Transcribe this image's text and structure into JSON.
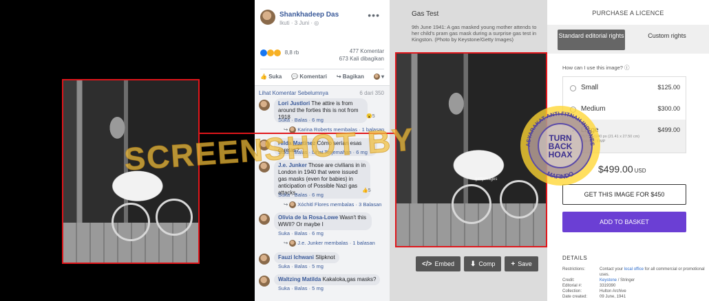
{
  "facebook": {
    "author": "Shankhadeep Das",
    "meta": "Ikuti · 3 Juni · ◎",
    "reaction_count": "8,8 rb",
    "comment_count": "477 Komentar",
    "share_count": "673 Kali dibagikan",
    "actions": [
      "Suka",
      "Komentari",
      "Bagikan"
    ],
    "view_previous": "Lihat Komentar Sebelumnya",
    "comment_counter": "6 dari 350",
    "comments": [
      {
        "author": "Lori Justlori",
        "text": "The attire is from around the forties this is not from 1918",
        "under": "Suka · Balas · 6 mg",
        "reaction": "5",
        "reply": "Karina Roberts membalas · 1 balasan"
      },
      {
        "author": "Hilda Martinez",
        "text": "Cómo serían esas caretas?",
        "under": "Suka · Balas · Lihat Terjemahan · 6 mg"
      },
      {
        "author": "J.e. Junker",
        "text": "Those are civilians in in London in 1940 that were issued gas masks (even for babies) in anticipation of Possible Nazi gas attacks.",
        "under": "Suka · Balas · 6 mg",
        "reaction": "5",
        "reply": "Xóchitl Flores membalas · 3 Balasan"
      },
      {
        "author": "Olivia de la Rosa-Lowe",
        "text": "Wasn't this WWII? Or maybe I",
        "under": "Suka · Balas · 6 mg",
        "reply": "J.e. Junker membalas · 1 balasan"
      },
      {
        "author": "Fauzi Ichwani",
        "text": "Slipknot",
        "under": "Suka · Balas · 5 mg"
      },
      {
        "author": "Waltzing Matilda",
        "text": "Kakaloka,gas masks?",
        "under": "Suka · Balas · 5 mg"
      }
    ]
  },
  "overlay": {
    "watermark": "SCREENSHOT BY",
    "stamp_ring": "MASYARAKAT ANTI FITNAH INDONESIA",
    "stamp_center": [
      "TURN",
      "BACK",
      "HOAX"
    ],
    "stamp_bottom": "MAFINDO"
  },
  "getty": {
    "title": "Gas Test",
    "caption": "9th June 1941: A gas masked young mother attends to her child's pram gas mask during a surprise gas test in Kingston. (Photo by Keystone/Getty Images)",
    "image_watermark": "gettyimages",
    "buttons": [
      {
        "icon": "</>",
        "label": "Embed"
      },
      {
        "icon": "⬇",
        "label": "Comp"
      },
      {
        "icon": "+",
        "label": "Save"
      }
    ]
  },
  "licence": {
    "heading": "PURCHASE A LICENCE",
    "tab_standard": "Standard editorial rights",
    "tab_custom": "Custom rights",
    "question": "How can I use this image? ⓘ",
    "sizes": [
      {
        "name": "Small",
        "price": "$125.00",
        "selected": false
      },
      {
        "name": "Medium",
        "price": "$300.00",
        "selected": false
      },
      {
        "name": "Large",
        "price": "$499.00",
        "selected": true,
        "dims": "2572 x 3240 px (21.41 x 27.50 cm)",
        "dims2": "300 dpi | 8 MP"
      }
    ],
    "total": "$499.00",
    "currency": "USD",
    "get_button": "GET THIS IMAGE FOR $450",
    "add_button": "ADD TO BASKET",
    "details_heading": "DETAILS",
    "details": [
      {
        "key": "Restrictions:",
        "pre": "Contact your ",
        "link": "local office",
        "post": " for all commercial or promotional uses."
      },
      {
        "key": "Credit:",
        "pre": "",
        "link": "Keystone",
        "post": " / Stringer"
      },
      {
        "key": "Editorial #:",
        "pre": "3319390",
        "link": "",
        "post": ""
      },
      {
        "key": "Collection:",
        "pre": "Hulton Archive",
        "link": "",
        "post": ""
      },
      {
        "key": "Date created:",
        "pre": "09 June, 1941",
        "link": "",
        "post": ""
      }
    ]
  }
}
